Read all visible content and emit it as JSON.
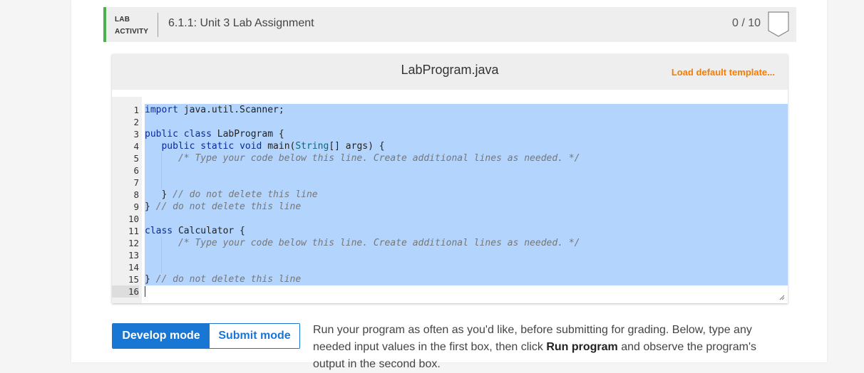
{
  "header": {
    "tag_line1": "LAB",
    "tag_line2": "ACTIVITY",
    "title": "6.1.1: Unit 3 Lab Assignment",
    "score": "0 / 10"
  },
  "editor": {
    "filename": "LabProgram.java",
    "load_default": "Load default template...",
    "lines": [
      {
        "n": "1",
        "code": "import java.util.Scanner;"
      },
      {
        "n": "2",
        "code": ""
      },
      {
        "n": "3",
        "code": "public class LabProgram {"
      },
      {
        "n": "4",
        "code": "   public static void main(String[] args) {"
      },
      {
        "n": "5",
        "code": "      /* Type your code below this line. Create additional lines as needed. */"
      },
      {
        "n": "6",
        "code": ""
      },
      {
        "n": "7",
        "code": ""
      },
      {
        "n": "8",
        "code": "   } // do not delete this line"
      },
      {
        "n": "9",
        "code": "} // do not delete this line"
      },
      {
        "n": "10",
        "code": ""
      },
      {
        "n": "11",
        "code": "class Calculator {"
      },
      {
        "n": "12",
        "code": "      /* Type your code below this line. Create additional lines as needed. */"
      },
      {
        "n": "13",
        "code": ""
      },
      {
        "n": "14",
        "code": ""
      },
      {
        "n": "15",
        "code": "} // do not delete this line"
      },
      {
        "n": "16",
        "code": ""
      }
    ]
  },
  "modes": {
    "develop": "Develop mode",
    "submit": "Submit mode"
  },
  "instructions": {
    "part1": "Run your program as often as you'd like, before submitting for grading. Below, type any needed input values in the first box, then click ",
    "bold": "Run program",
    "part2": " and observe the program's output in the second box."
  },
  "colors": {
    "accent_green": "#4caf50",
    "primary_blue": "#1976d2",
    "orange_link": "#f57c00",
    "selection": "#b3d4fc"
  }
}
